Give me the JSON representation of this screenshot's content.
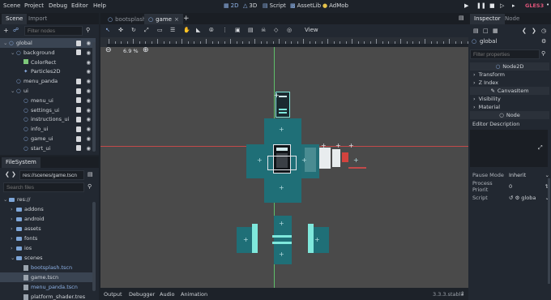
{
  "menu": [
    "Scene",
    "Project",
    "Debug",
    "Editor",
    "Help"
  ],
  "workspaces": [
    {
      "icon": "2d",
      "label": "2D"
    },
    {
      "icon": "3d",
      "label": "3D"
    },
    {
      "icon": "script",
      "label": "Script"
    },
    {
      "icon": "assetlib",
      "label": "AssetLib"
    },
    {
      "icon": "admob",
      "label": "AdMob"
    }
  ],
  "renderer": "GLES3",
  "scene_tabs": {
    "scene": "Scene",
    "import": "Import"
  },
  "scene_filter_placeholder": "Filter nodes",
  "scene_tree": [
    {
      "label": "global",
      "depth": 0,
      "icon": "node2d",
      "script": true,
      "selected": true
    },
    {
      "label": "background",
      "depth": 1,
      "icon": "node2d",
      "script": true
    },
    {
      "label": "ColorRect",
      "depth": 2,
      "icon": "colorrect"
    },
    {
      "label": "Particles2D",
      "depth": 2,
      "icon": "particles"
    },
    {
      "label": "menu_panda",
      "depth": 1,
      "icon": "node2d",
      "script": true
    },
    {
      "label": "ui",
      "depth": 1,
      "icon": "node2d",
      "script": true
    },
    {
      "label": "menu_ui",
      "depth": 2,
      "icon": "node2d",
      "script": true
    },
    {
      "label": "settings_ui",
      "depth": 2,
      "icon": "node2d",
      "script": true
    },
    {
      "label": "instructions_ui",
      "depth": 2,
      "icon": "node2d",
      "script": true
    },
    {
      "label": "info_ui",
      "depth": 2,
      "icon": "node2d",
      "script": true
    },
    {
      "label": "game_ui",
      "depth": 2,
      "icon": "node2d",
      "script": true
    },
    {
      "label": "start_ui",
      "depth": 2,
      "icon": "node2d",
      "script": true
    }
  ],
  "filesystem": {
    "title": "FileSystem",
    "path": "res://scenes/game.tscn",
    "search_placeholder": "Search files",
    "items": [
      {
        "label": "res://",
        "depth": 0,
        "type": "folder"
      },
      {
        "label": "addons",
        "depth": 1,
        "type": "folder"
      },
      {
        "label": "android",
        "depth": 1,
        "type": "folder"
      },
      {
        "label": "assets",
        "depth": 1,
        "type": "folder"
      },
      {
        "label": "fonts",
        "depth": 1,
        "type": "folder"
      },
      {
        "label": "ios",
        "depth": 1,
        "type": "folder"
      },
      {
        "label": "scenes",
        "depth": 1,
        "type": "folder"
      },
      {
        "label": "bootsplash.tscn",
        "depth": 2,
        "type": "file"
      },
      {
        "label": "game.tscn",
        "depth": 2,
        "type": "file",
        "selected": true
      },
      {
        "label": "menu_panda.tscn",
        "depth": 2,
        "type": "file"
      },
      {
        "label": "platform_shader.tres",
        "depth": 2,
        "type": "file"
      }
    ]
  },
  "editor_tabs": [
    {
      "label": "bootsplash",
      "active": false
    },
    {
      "label": "game",
      "active": true
    }
  ],
  "viewport": {
    "zoom": "6.9 %",
    "view_menu": "View"
  },
  "bottom_tabs": [
    "Output",
    "Debugger",
    "Audio",
    "Animation"
  ],
  "version": "3.3.3.stable",
  "inspector": {
    "tabs": {
      "inspector": "Inspector",
      "node": "Node"
    },
    "object": "global",
    "filter_placeholder": "Filter properties",
    "node_class": "Node2D",
    "sections": [
      "Transform",
      "Z Index"
    ],
    "canvas_item": "CanvasItem",
    "sections2": [
      "Visibility",
      "Material"
    ],
    "node_label": "Node",
    "editor_description": "Editor Description",
    "props": [
      {
        "name": "Pause Mode",
        "value": "Inherit"
      },
      {
        "name": "Process Priorit",
        "value": "0"
      },
      {
        "name": "Script",
        "value": "globa"
      }
    ]
  },
  "colors": {
    "accent": "#4a8ed8",
    "renderer": "#e0557a",
    "viewport_bg": "#4a4a4a",
    "tile": "#1f6f77",
    "highlight": "#7fe8dc"
  }
}
